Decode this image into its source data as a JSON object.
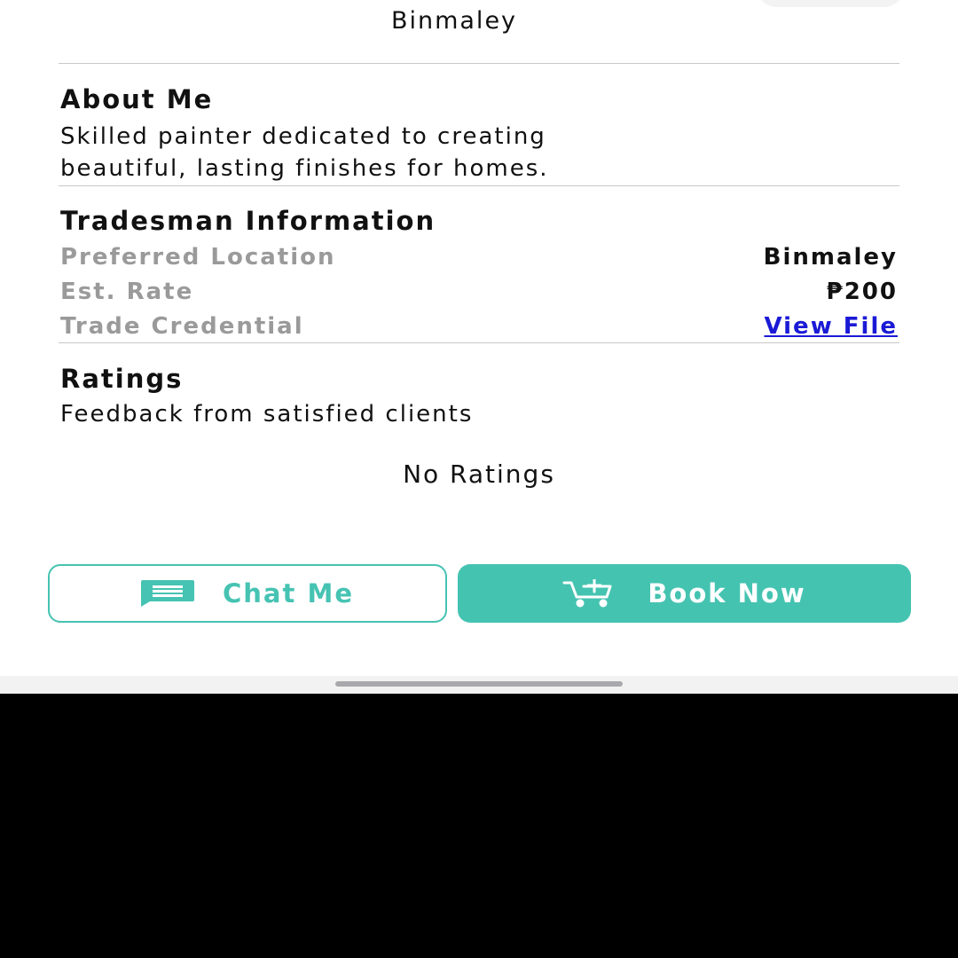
{
  "header": {
    "location": "Binmaley"
  },
  "about": {
    "title": "About Me",
    "line1": "Skilled painter dedicated to creating",
    "line2": "beautiful, lasting finishes for homes."
  },
  "tradesman": {
    "title": "Tradesman Information",
    "rows": [
      {
        "label": "Preferred Location",
        "value": "Binmaley"
      },
      {
        "label": "Est. Rate",
        "value": "₱200"
      },
      {
        "label": "Trade Credential",
        "value": "View File"
      }
    ]
  },
  "ratings": {
    "title": "Ratings",
    "subtitle": "Feedback from satisfied clients",
    "empty_text": "No Ratings"
  },
  "actions": {
    "chat_label": "Chat Me",
    "book_label": "Book Now",
    "chat_icon": "chat-message-icon",
    "book_icon": "cart-add-icon",
    "accent_color": "#45c3b1",
    "link_color": "#1a1ad6"
  }
}
